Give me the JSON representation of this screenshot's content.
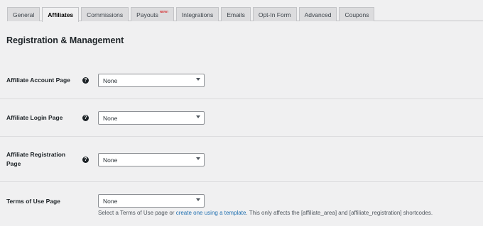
{
  "tabs": [
    {
      "label": "General"
    },
    {
      "label": "Affiliates"
    },
    {
      "label": "Commissions"
    },
    {
      "label": "Payouts",
      "badge": "NEW!"
    },
    {
      "label": "Integrations"
    },
    {
      "label": "Emails"
    },
    {
      "label": "Opt-In Form"
    },
    {
      "label": "Advanced"
    },
    {
      "label": "Coupons"
    }
  ],
  "active_tab": "Affiliates",
  "section_title": "Registration & Management",
  "rows": [
    {
      "label": "Affiliate Account Page",
      "value": "None"
    },
    {
      "label": "Affiliate Login Page",
      "value": "None"
    },
    {
      "label": "Affiliate Registration Page",
      "value": "None"
    },
    {
      "label": "Terms of Use Page",
      "value": "None"
    }
  ],
  "help_glyph": "?",
  "terms_description": {
    "before": "Select a Terms of Use page or ",
    "link": "create one using a template",
    "after": ". This only affects the [affiliate_area] and [affiliate_registration] shortcodes."
  },
  "colors": {
    "background": "#f0f0f1",
    "tab_inactive": "#dcdcde",
    "link": "#2271b1",
    "new_badge": "#d63638"
  }
}
